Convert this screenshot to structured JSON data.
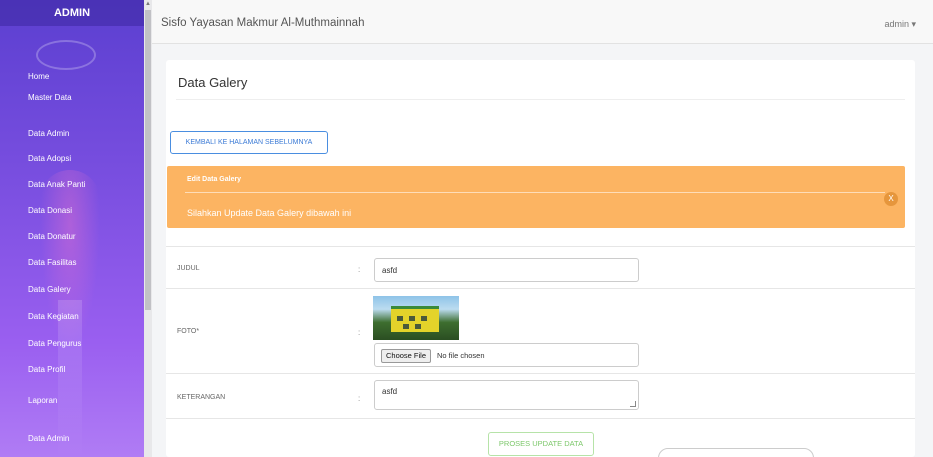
{
  "sidebar": {
    "brand": "ADMIN",
    "items": [
      {
        "label": "Home"
      },
      {
        "label": "Master Data"
      },
      {
        "label": "Data Admin"
      },
      {
        "label": "Data Adopsi"
      },
      {
        "label": "Data Anak Panti"
      },
      {
        "label": "Data Donasi"
      },
      {
        "label": "Data Donatur"
      },
      {
        "label": "Data Fasilitas"
      },
      {
        "label": "Data Galery"
      },
      {
        "label": "Data Kegiatan"
      },
      {
        "label": "Data Pengurus"
      },
      {
        "label": "Data Profil"
      },
      {
        "label": "Laporan"
      },
      {
        "label": "Data Admin"
      }
    ]
  },
  "topbar": {
    "title": "Sisfo Yayasan Makmur Al-Muthmainnah",
    "user_menu": "admin ▾"
  },
  "page": {
    "title": "Data Galery",
    "back_button": "KEMBALI KE HALAMAN SEBELUMNYA"
  },
  "alert": {
    "heading": "Edit Data Galery",
    "message": "Silahkan Update Data Galery dibawah ini",
    "close_label": "X"
  },
  "form": {
    "colon": ":",
    "judul": {
      "label": "JUDUL",
      "value": "asfd"
    },
    "foto": {
      "label": "FOTO*",
      "file_button": "Choose File",
      "file_status": "No file chosen"
    },
    "keterangan": {
      "label": "KETERANGAN",
      "value": "asfd"
    },
    "submit": "PROSES UPDATE DATA"
  },
  "colors": {
    "sidebar_gradient_top": "#5b3fd0",
    "sidebar_gradient_bottom": "#b07cf5",
    "alert_bg": "#fcb462",
    "back_button": "#3c7bd6",
    "submit_button": "#7cc76a"
  }
}
